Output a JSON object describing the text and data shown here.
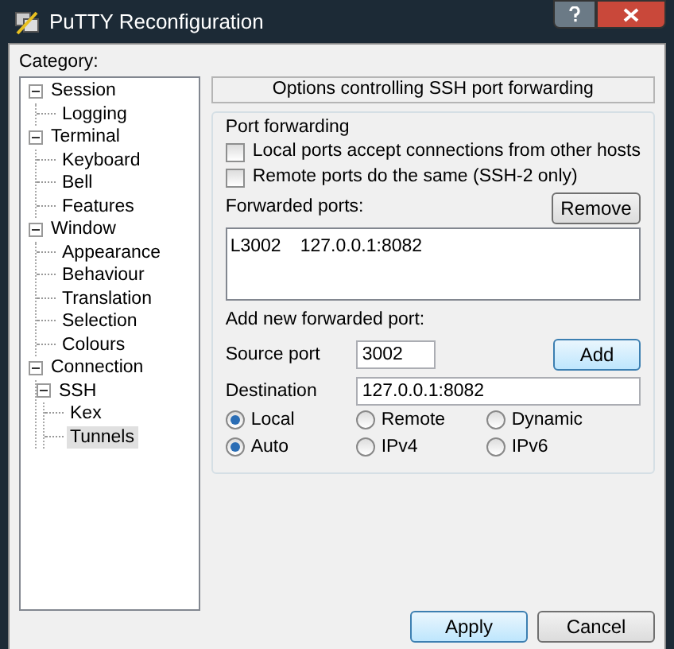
{
  "window": {
    "title": "PuTTY Reconfiguration"
  },
  "category_label": "Category:",
  "tree": [
    {
      "label": "Session",
      "expanded": true,
      "selected": false,
      "children": [
        {
          "label": "Logging",
          "selected": false
        }
      ]
    },
    {
      "label": "Terminal",
      "expanded": true,
      "selected": false,
      "children": [
        {
          "label": "Keyboard",
          "selected": false
        },
        {
          "label": "Bell",
          "selected": false
        },
        {
          "label": "Features",
          "selected": false
        }
      ]
    },
    {
      "label": "Window",
      "expanded": true,
      "selected": false,
      "children": [
        {
          "label": "Appearance",
          "selected": false
        },
        {
          "label": "Behaviour",
          "selected": false
        },
        {
          "label": "Translation",
          "selected": false
        },
        {
          "label": "Selection",
          "selected": false
        },
        {
          "label": "Colours",
          "selected": false
        }
      ]
    },
    {
      "label": "Connection",
      "expanded": true,
      "selected": false,
      "children": [
        {
          "label": "SSH",
          "expanded": true,
          "selected": false,
          "children": [
            {
              "label": "Kex",
              "selected": false
            },
            {
              "label": "Tunnels",
              "selected": true
            }
          ]
        }
      ]
    }
  ],
  "panel_title": "Options controlling SSH port forwarding",
  "group_title": "Port forwarding",
  "checkboxes": [
    {
      "label": "Local ports accept connections from other hosts",
      "checked": false
    },
    {
      "label": "Remote ports do the same (SSH-2 only)",
      "checked": false
    }
  ],
  "forwarded_label": "Forwarded ports:",
  "remove_button": "Remove",
  "forwarded_ports": [
    {
      "port": "L3002",
      "destination": "127.0.0.1:8082"
    }
  ],
  "add_label": "Add new forwarded port:",
  "source_port": {
    "label": "Source port",
    "value": "3002"
  },
  "add_button": "Add",
  "destination": {
    "label": "Destination",
    "value": "127.0.0.1:8082"
  },
  "radio_rows": [
    [
      {
        "label": "Local",
        "selected": true
      },
      {
        "label": "Remote",
        "selected": false
      },
      {
        "label": "Dynamic",
        "selected": false
      }
    ],
    [
      {
        "label": "Auto",
        "selected": true
      },
      {
        "label": "IPv4",
        "selected": false
      },
      {
        "label": "IPv6",
        "selected": false
      }
    ]
  ],
  "buttons": [
    {
      "label": "Apply",
      "default": true
    },
    {
      "label": "Cancel",
      "default": false
    }
  ]
}
